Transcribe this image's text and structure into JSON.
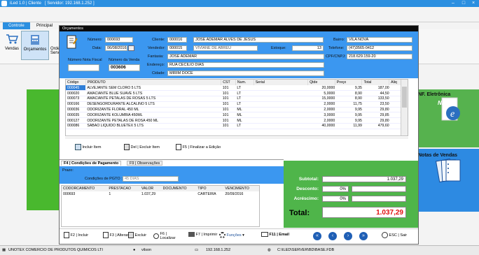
{
  "window": {
    "title": "iLed 1.0 | Cliente",
    "server": "[ Servidor: 192.168.1.252 ]"
  },
  "ribbon": {
    "tabs": [
      "Controle",
      "Principal"
    ],
    "buttons": [
      "Vendas",
      "Orçamentos",
      "Ordem Serv"
    ]
  },
  "side": {
    "nfe_label": "NF. Eletrônica",
    "notas_label": "Notas de Vendas"
  },
  "dialog": {
    "title": "Orçamentos",
    "numero_label": "Número:",
    "numero": "000693",
    "data_label": "Data:",
    "data": "06/08/2016",
    "nota_fiscal_label": "Número Nota Fiscal",
    "numero_venda_label": "Número da Venda",
    "numero_venda": "003606",
    "cliente_label": "Cliente:",
    "cliente_code": "000016",
    "cliente_nome": "JOSE ADEMAR ALVES DE JESUS",
    "vendedor_label": "Vendedor:",
    "vendedor_code": "000015",
    "vendedor_nome": "VIVIANE DE ABREU",
    "estoque_label": "Estoque:",
    "estoque": "13",
    "fantasia_label": "Fantasia:",
    "fantasia": "JOSE ADEMAR",
    "endereco_label": "Endereço:",
    "endereco": "RUA CECILIO DIAS",
    "cidade_label": "Cidade:",
    "cidade": "MIRIM DOCE",
    "bairro_label": "Bairro:",
    "bairro": "VILA NOVA",
    "telefone_label": "Telefone:",
    "telefone": "(47)3565-0412",
    "cpf_label": "CPF/CNPJ:",
    "cpf": "218.629.159-20"
  },
  "items": {
    "columns": [
      "Código",
      "PRODUTO",
      "CST",
      "Num.",
      "Serial",
      "Qtde",
      "Preço",
      "Total",
      "Aliq"
    ],
    "rows": [
      [
        "000045",
        "ALVEJANTE SEM CLORO 5 LTS",
        "101",
        "LT",
        "",
        "20,0000",
        "9,35",
        "187,00",
        ""
      ],
      [
        "000020",
        "AMACIANTE BLUE SUAVE 5 LTS",
        "101",
        "LT",
        "",
        "5,0000",
        "8,90",
        "44,50",
        ""
      ],
      [
        "000073",
        "AMACIANTE PETALAS DE ROSAS 5 LTS",
        "101",
        "LT",
        "",
        "15,0000",
        "8,90",
        "133,50",
        ""
      ],
      [
        "000166",
        "DESENGORDURANTE ALCALINO 5 LTS",
        "101",
        "LT",
        "",
        "2,0000",
        "11,75",
        "23,50",
        ""
      ],
      [
        "000036",
        "ODORIZANTE FLORAL 450 ML",
        "101",
        "ML",
        "",
        "2,0000",
        "9,95",
        "29,80",
        ""
      ],
      [
        "000035",
        "ODORIZANTE KOLUMBIA 450ML",
        "101",
        "ML",
        "",
        "3,0000",
        "9,95",
        "29,85",
        ""
      ],
      [
        "000127",
        "ODORIZANTE PETALAS DE ROSA 450 ML",
        "101",
        "ML",
        "",
        "2,0000",
        "9,95",
        "29,80",
        ""
      ],
      [
        "000086",
        "SABAO LIQUIDO BLUETEX 5 LTS",
        "101",
        "LT",
        "",
        "40,0000",
        "11,99",
        "479,60",
        ""
      ]
    ]
  },
  "actions": {
    "incluir": "Incluir Item",
    "excluir": "Del | Excluir Item",
    "finalizar": "F5 | Finalizar a Edição"
  },
  "payment": {
    "tab_active": "F4 | Condições de Pagamento",
    "tab_obs": "F9 | Observações",
    "prazo_label": "Prazo:",
    "condicoes_label": "Condições de PGTO :",
    "condicoes_value": "45 DIAS",
    "columns": [
      "CODORCAMENTO",
      "PRESTACAO",
      "VALOR",
      "DOCUMENTO",
      "TIPO",
      "VENCIMENTO"
    ],
    "rows": [
      [
        "000693",
        "1",
        "1.037,29",
        "",
        "CARTEIRA",
        "20/09/2016"
      ]
    ]
  },
  "totals": {
    "subtotal_label": "Subtotal:",
    "subtotal": "1.037,29",
    "desconto_label": "Desconto:",
    "desconto": "0%",
    "acrescimo_label": "Acréscimo:",
    "acrescimo": "0%",
    "total_label": "Total:",
    "total": "1.037,29"
  },
  "footer": {
    "incluir": "F2 | Incluir",
    "alterar": "F3 | Alterar",
    "excluir": "Excluir",
    "localizar": "F6 | Localizar",
    "imprimir": "F7 | Imprimir",
    "funcoes": "Funções",
    "email": "F11 | Email",
    "sair": "ESC | Sair"
  },
  "status": {
    "company": "UNOTEX COMERCIO DE PRODUTOS QUIMICOS LTI",
    "user": "vilson",
    "ip": "192.168.1.252",
    "db": "C:\\ILED\\SERVER\\BD\\BASE.FDB"
  },
  "colors": {
    "accent": "#2b8fe0",
    "header": "#3b97f0",
    "green": "#4fb54a",
    "total_red": "#e01010"
  }
}
